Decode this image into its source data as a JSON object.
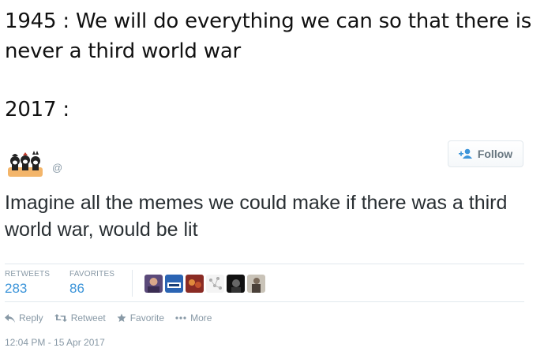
{
  "caption": {
    "line1": "1945 : We will do everything we can so that there is never a third world war",
    "line2": "2017 :"
  },
  "tweet": {
    "handle": "@",
    "text": "Imagine all the memes we could make if there was a third world war, would be lit",
    "follow_label": "Follow",
    "stats": {
      "retweets_label": "RETWEETS",
      "retweets_value": "283",
      "favorites_label": "FAVORITES",
      "favorites_value": "86"
    },
    "actions": {
      "reply": "Reply",
      "retweet": "Retweet",
      "favorite": "Favorite",
      "more": "More"
    },
    "timestamp": "12:04 PM - 15 Apr 2017",
    "colors": {
      "link_blue": "#3b94d9",
      "muted_gray": "#8899a6",
      "text": "#292f33",
      "avatar_orange": "#f3b56a"
    }
  }
}
